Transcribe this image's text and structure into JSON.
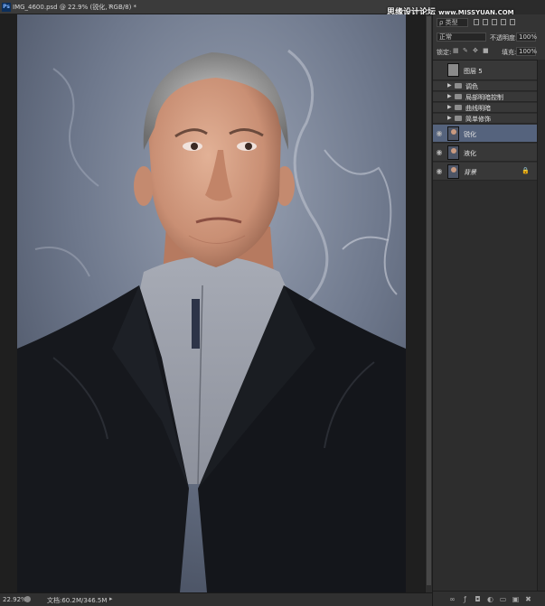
{
  "app": {
    "icon_label": "Ps"
  },
  "document_tab": {
    "title": "IMG_4600.psd @ 22.9% (锐化, RGB/8) *",
    "close_label": "×"
  },
  "watermark": {
    "text": "思缘设计论坛",
    "url": "www.MISSYUAN.COM"
  },
  "status_bar": {
    "zoom": "22.92%",
    "doc_info": "文档:60.2M/346.5M",
    "arrow": "▸"
  },
  "layers_panel": {
    "filter": {
      "label": "ρ 类型"
    },
    "blend_mode": "正常",
    "opacity_label": "不透明度:",
    "opacity_value": "100%",
    "lock_label": "锁定:",
    "fill_label": "填充:",
    "fill_value": "100%",
    "layers": [
      {
        "name": "图层 5",
        "kind": "layer",
        "visible": false,
        "active": false
      },
      {
        "name": "调色",
        "kind": "group",
        "visible": false,
        "active": false
      },
      {
        "name": "局部明暗控制",
        "kind": "group",
        "visible": false,
        "active": false
      },
      {
        "name": "曲线明暗",
        "kind": "group",
        "visible": false,
        "active": false
      },
      {
        "name": "简单修饰",
        "kind": "group",
        "visible": false,
        "active": false
      },
      {
        "name": "锐化",
        "kind": "layer",
        "visible": true,
        "active": true
      },
      {
        "name": "液化",
        "kind": "layer",
        "visible": true,
        "active": false
      },
      {
        "name": "背景",
        "kind": "background",
        "visible": true,
        "active": false,
        "locked": true
      }
    ],
    "footer_icons": [
      "link-layers-icon",
      "fx-icon",
      "add-mask-icon",
      "adjustment-layer-icon",
      "new-group-icon",
      "new-layer-icon",
      "delete-layer-icon"
    ]
  },
  "colors": {
    "panel_bg": "#343434",
    "active_layer": "#55637d",
    "canvas_bg": "#1f1f1f"
  }
}
